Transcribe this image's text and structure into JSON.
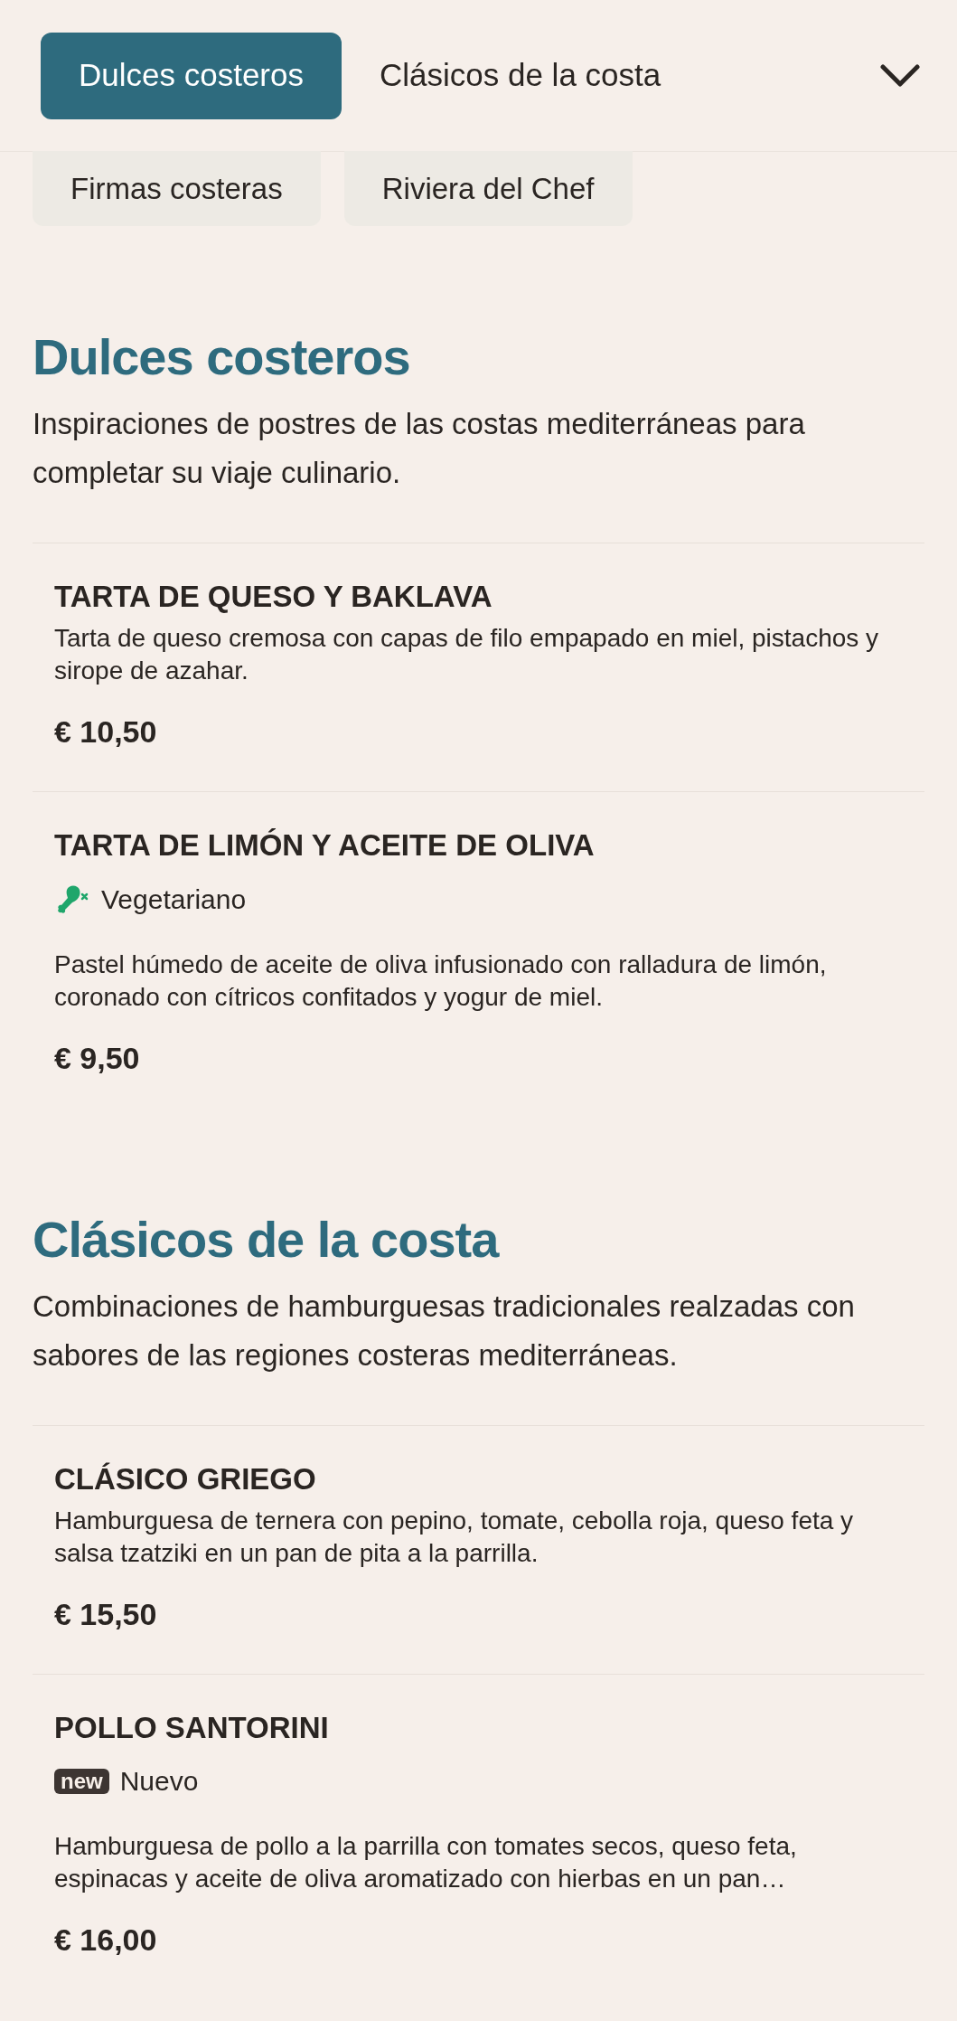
{
  "tabs": [
    {
      "label": "Dulces costeros",
      "selected": true
    },
    {
      "label": "Clásicos de la costa",
      "selected": false
    }
  ],
  "more_tabs": [
    {
      "label": "Firmas costeras",
      "selected": false
    },
    {
      "label": "Riviera del Chef",
      "selected": false
    }
  ],
  "sections": [
    {
      "title": "Dulces costeros",
      "description": "Inspiraciones de postres de las costas mediterráneas para completar su viaje culinario.",
      "items": [
        {
          "name": "TARTA DE QUESO Y BAKLAVA",
          "description": "Tarta de queso cremosa con capas de filo empapado en miel, pistachos y sirope de azahar.",
          "price": "€ 10,50"
        },
        {
          "name": "TARTA DE LIMÓN Y ACEITE DE OLIVA",
          "tag": {
            "kind": "vegetarian",
            "label": "Vegetariano"
          },
          "description": "Pastel húmedo de aceite de oliva infusionado con ralladura de limón, coronado con cítricos confitados y yogur de miel.",
          "price": "€ 9,50"
        }
      ]
    },
    {
      "title": "Clásicos de la costa",
      "description": "Combinaciones de hamburguesas tradicionales realzadas con sabores de las regiones costeras mediterráneas.",
      "items": [
        {
          "name": "CLÁSICO GRIEGO",
          "description": "Hamburguesa de ternera con pepino, tomate, cebolla roja, queso feta y salsa tzatziki en un pan de pita a la parrilla.",
          "price": "€ 15,50"
        },
        {
          "name": "POLLO SANTORINI",
          "tag": {
            "kind": "new",
            "badge": "new",
            "label": "Nuevo"
          },
          "description": "Hamburguesa de pollo a la parrilla con tomates secos, queso feta, espinacas y aceite de oliva aromatizado con hierbas en un pan…",
          "price": "€ 16,00"
        }
      ]
    }
  ]
}
